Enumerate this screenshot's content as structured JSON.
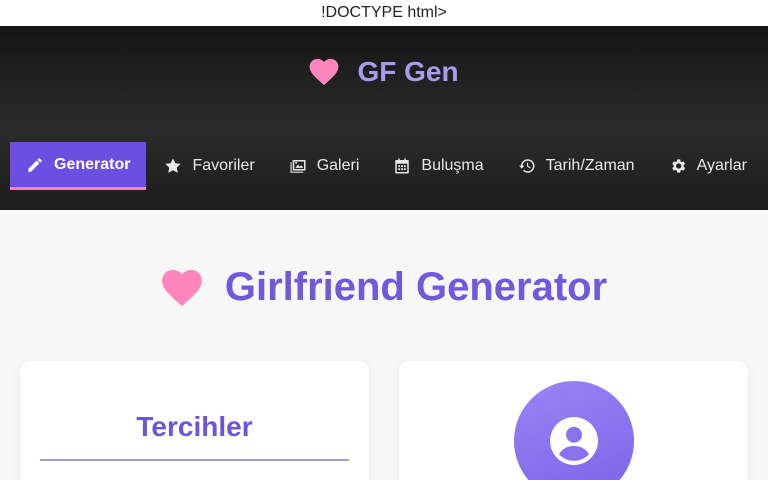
{
  "stray_text": "!DOCTYPE html>",
  "brand": {
    "title": "GF Gen",
    "icon": "heart-icon"
  },
  "nav": {
    "items": [
      {
        "label": "Generator",
        "icon": "pencil-icon",
        "active": true
      },
      {
        "label": "Favoriler",
        "icon": "star-icon",
        "active": false
      },
      {
        "label": "Galeri",
        "icon": "images-icon",
        "active": false
      },
      {
        "label": "Buluşma",
        "icon": "calendar-icon",
        "active": false
      },
      {
        "label": "Tarih/Zaman",
        "icon": "history-icon",
        "active": false
      },
      {
        "label": "Ayarlar",
        "icon": "gear-icon",
        "active": false
      }
    ]
  },
  "main": {
    "title": "Girlfriend Generator",
    "icon": "heart-icon"
  },
  "preferences_card": {
    "title": "Tercihler"
  },
  "profile_card": {
    "icon": "user-circle-icon"
  },
  "colors": {
    "accent": "#6c4fe0",
    "title": "#7158dd",
    "heart": "#ff7eb6",
    "active_underline": "#ff79c6",
    "header_bg": "#222222"
  }
}
